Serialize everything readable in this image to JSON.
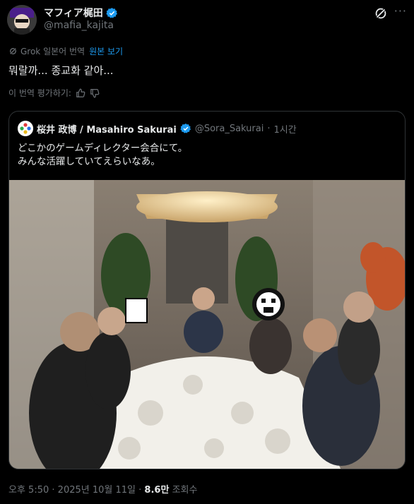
{
  "author": {
    "display_name": "マフィア梶田",
    "handle": "@mafia_kajita"
  },
  "translation": {
    "label": "Grok 일본어 번역",
    "show_original": "원본 보기"
  },
  "tweet_text": "뭐랄까... 종교화 같아...",
  "rate": {
    "label": "이 번역 평가하기:"
  },
  "quoted": {
    "display_name": "桜井 政博 / Masahiro Sakurai",
    "handle": "@Sora_Sakurai",
    "separator": "·",
    "time": "1시간",
    "lines": [
      "どこかのゲームディレクター会合にて。",
      "みんな活躍していてえらいなあ。"
    ]
  },
  "footer": {
    "time": "오후 5:50",
    "separator1": "·",
    "date": "2025년 10월 11일",
    "separator2": "·",
    "views": "8.6만",
    "views_label": "조회수"
  },
  "colors": {
    "accent": "#1d9bf0",
    "muted": "#71767b",
    "text": "#e7e9ea",
    "border": "#2f3336"
  },
  "icons": {
    "verified": "verified-badge-icon",
    "grok": "grok-icon",
    "more": "more-icon",
    "thumbs_up": "thumbs-up-icon",
    "thumbs_down": "thumbs-down-icon"
  }
}
